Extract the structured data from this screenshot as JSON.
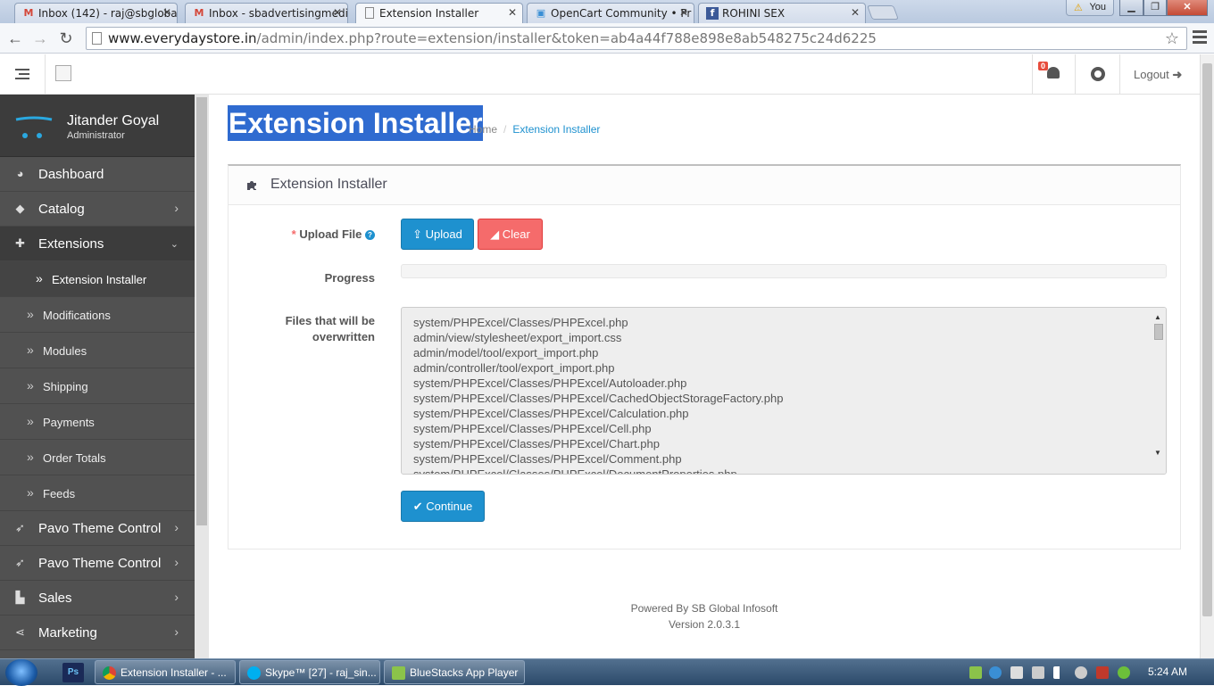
{
  "browser": {
    "tabs": [
      {
        "title": "Inbox (142) - raj@sbgloba",
        "favicon": "gmail-icon"
      },
      {
        "title": "Inbox - sbadvertisingmedi",
        "favicon": "gmail-icon"
      },
      {
        "title": "Extension Installer",
        "favicon": "page-icon",
        "active": true
      },
      {
        "title": "OpenCart Community • Pr",
        "favicon": "opencart-icon"
      },
      {
        "title": "ROHINI SEX",
        "favicon": "facebook-icon"
      }
    ],
    "profile_badge": "You",
    "url_host": "www.everydaystore.in",
    "url_path": "/admin/index.php?route=extension/installer&token=ab4a44f788e898e8ab548275c24d6225"
  },
  "header": {
    "notification_count": "0",
    "logout_label": "Logout"
  },
  "sidebar": {
    "user_name": "Jitander Goyal",
    "user_role": "Administrator",
    "items": [
      {
        "label": "Dashboard",
        "icon": "dashboard-icon"
      },
      {
        "label": "Catalog",
        "icon": "tags-icon"
      },
      {
        "label": "Extensions",
        "icon": "puzzle-icon"
      },
      {
        "label": "Pavo Theme Control",
        "icon": "rocket-icon"
      },
      {
        "label": "Pavo Theme Control",
        "icon": "rocket-icon"
      },
      {
        "label": "Sales",
        "icon": "cart-icon"
      },
      {
        "label": "Marketing",
        "icon": "share-icon"
      }
    ],
    "subitems": [
      {
        "label": "Extension Installer",
        "active": true
      },
      {
        "label": "Modifications"
      },
      {
        "label": "Modules"
      },
      {
        "label": "Shipping"
      },
      {
        "label": "Payments"
      },
      {
        "label": "Order Totals"
      },
      {
        "label": "Feeds"
      }
    ]
  },
  "page": {
    "title": "Extension Installer",
    "breadcrumb_home": "Home",
    "breadcrumb_current": "Extension Installer",
    "panel_title": "Extension Installer",
    "upload_label": "Upload File",
    "upload_button": "Upload",
    "clear_button": "Clear",
    "progress_label": "Progress",
    "progress_value": 0,
    "files_label_line1": "Files that will be",
    "files_label_line2": "overwritten",
    "files": [
      "system/PHPExcel/Classes/PHPExcel.php",
      "admin/view/stylesheet/export_import.css",
      "admin/model/tool/export_import.php",
      "admin/controller/tool/export_import.php",
      "system/PHPExcel/Classes/PHPExcel/Autoloader.php",
      "system/PHPExcel/Classes/PHPExcel/CachedObjectStorageFactory.php",
      "system/PHPExcel/Classes/PHPExcel/Calculation.php",
      "system/PHPExcel/Classes/PHPExcel/Cell.php",
      "system/PHPExcel/Classes/PHPExcel/Chart.php",
      "system/PHPExcel/Classes/PHPExcel/Comment.php",
      "system/PHPExcel/Classes/PHPExcel/DocumentProperties.php"
    ],
    "continue_button": "Continue"
  },
  "footer": {
    "powered_by": "Powered By SB Global Infosoft",
    "version": "Version 2.0.3.1"
  },
  "taskbar": {
    "tasks": [
      {
        "label": "Extension Installer - ...",
        "icon": "chrome-icon"
      },
      {
        "label": "Skype™ [27] - raj_sin...",
        "icon": "skype-icon"
      },
      {
        "label": "BlueStacks App Player",
        "icon": "bluestacks-icon"
      }
    ],
    "pinned_ps": "Ps",
    "clock": "5:24 AM"
  },
  "colors": {
    "primary": "#1e91cf",
    "danger": "#f56b6b",
    "sidebar": "#515151",
    "selection": "#2f6bd0"
  }
}
